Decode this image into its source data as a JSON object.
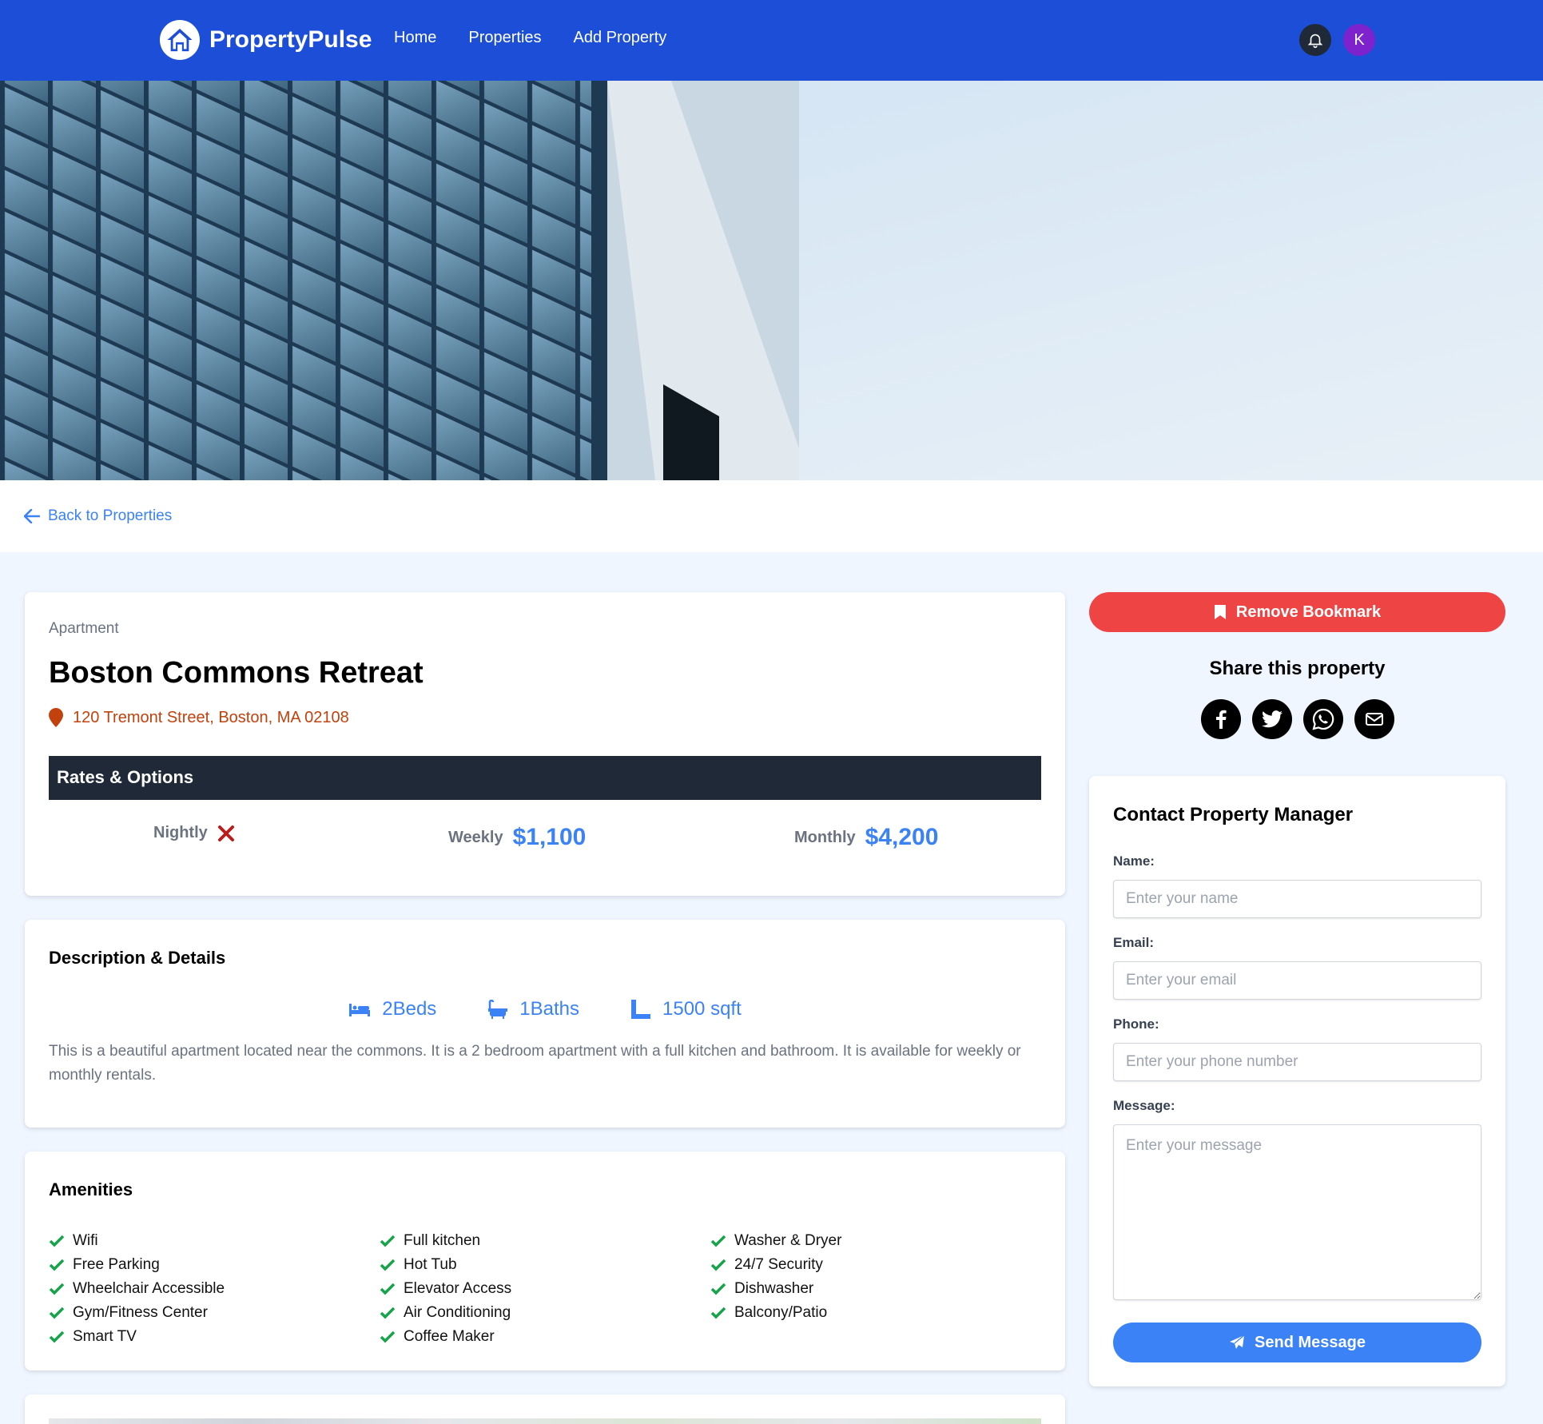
{
  "navbar": {
    "brand": "PropertyPulse",
    "links": [
      "Home",
      "Properties",
      "Add Property"
    ],
    "avatar_initial": "K"
  },
  "back_link": "Back to Properties",
  "property": {
    "type": "Apartment",
    "name": "Boston Commons Retreat",
    "address": "120 Tremont Street, Boston, MA 02108",
    "rates_title": "Rates & Options",
    "rates": {
      "nightly_label": "Nightly",
      "weekly_label": "Weekly",
      "weekly_value": "$1,100",
      "monthly_label": "Monthly",
      "monthly_value": "$4,200"
    }
  },
  "details": {
    "title": "Description & Details",
    "beds": "2Beds",
    "baths": "1Baths",
    "sqft": "1500 sqft",
    "description": "This is a beautiful apartment located near the commons. It is a 2 bedroom apartment with a full kitchen and bathroom. It is available for weekly or monthly rentals."
  },
  "amenities": {
    "title": "Amenities",
    "columns": [
      [
        "Wifi",
        "Free Parking",
        "Wheelchair Accessible",
        "Gym/Fitness Center",
        "Smart TV"
      ],
      [
        "Full kitchen",
        "Hot Tub",
        "Elevator Access",
        "Air Conditioning",
        "Coffee Maker"
      ],
      [
        "Washer & Dryer",
        "24/7 Security",
        "Dishwasher",
        "Balcony/Patio"
      ]
    ]
  },
  "sidebar": {
    "bookmark_label": "Remove Bookmark",
    "share_title": "Share this property",
    "share_icons": [
      "facebook-icon",
      "twitter-icon",
      "whatsapp-icon",
      "email-icon"
    ],
    "contact": {
      "title": "Contact Property Manager",
      "name_label": "Name:",
      "name_placeholder": "Enter your name",
      "email_label": "Email:",
      "email_placeholder": "Enter your email",
      "phone_label": "Phone:",
      "phone_placeholder": "Enter your phone number",
      "message_label": "Message:",
      "message_placeholder": "Enter your message",
      "send_label": "Send Message"
    }
  },
  "colors": {
    "nav_bg": "#1d4ed8",
    "accent_blue": "#3b82f6",
    "bookmark_red": "#ef4444",
    "address_orange": "#c2410c",
    "check_green": "#16a34a",
    "rates_bar": "#1f2937"
  }
}
